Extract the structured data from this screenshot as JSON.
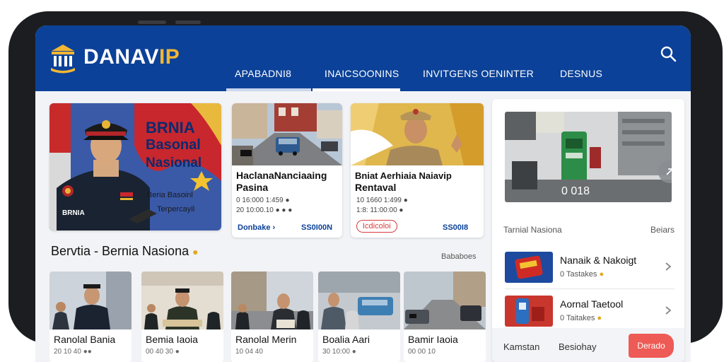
{
  "app": {
    "logo_main": "DANAV",
    "logo_accent": "IP"
  },
  "nav": {
    "tabs": [
      {
        "label": "APABADNI8"
      },
      {
        "label": "INAICSOONINS"
      },
      {
        "label": "INVITGENS OENINTER"
      },
      {
        "label": "DESNUS"
      }
    ],
    "active_tab": 1
  },
  "hero": {
    "title_line1": "BRNIA",
    "title_line2": "Basonal",
    "title_line3": "Nasional",
    "caption_line1": "Beria Basoinl",
    "caption_line2": "Terpercayil",
    "badge": "BRNIA"
  },
  "stories": [
    {
      "title_line1": "HaclanaNanciaaing",
      "title_line2": "Pasina",
      "meta_line1": "0 16:000 1:459 ●",
      "meta_line2": "20 10:00.10 ● ● ●",
      "link_label": "Donbake ›",
      "count": "SS0I00N"
    },
    {
      "title_line1": "Bniat Aerhiaia Naiavip",
      "title_line2": "Rentaval",
      "meta_line1": "10 1660 1:499 ●",
      "meta_line2": "1:8: 11:00:00 ●",
      "pill_label": "Icdicoloi",
      "count": "SS00I8"
    }
  ],
  "section": {
    "title": "Bervtia - Bernia Nasiona",
    "link": "Bababoes"
  },
  "thumbs": [
    {
      "label": "Ranolal Bania",
      "meta": "20 10 40 ●●"
    },
    {
      "label": "Bemia Iaoia",
      "meta": "00 40 30 ●"
    },
    {
      "label": "Ranolal Merin",
      "meta": "10 04 40"
    },
    {
      "label": "Boalia Aari",
      "meta": "30 10:00 ●"
    },
    {
      "label": "Bamir Iaoia",
      "meta": "00 00 10"
    }
  ],
  "side": {
    "feature_caption": "0 018",
    "header_title": "Tarnial Nasiona",
    "header_link": "Beiars",
    "items": [
      {
        "title": "Nanaik & Nakoigt",
        "meta": "0 Tastakes"
      },
      {
        "title": "Aornal Taetool",
        "meta": "0 Taitakes"
      }
    ]
  },
  "bottom": {
    "item1": "Kamstan",
    "item2": "Besiohay",
    "cta": "Derado"
  },
  "colors": {
    "brand": "#0b4198",
    "accent": "#f2b633",
    "cta": "#ee5a55"
  }
}
